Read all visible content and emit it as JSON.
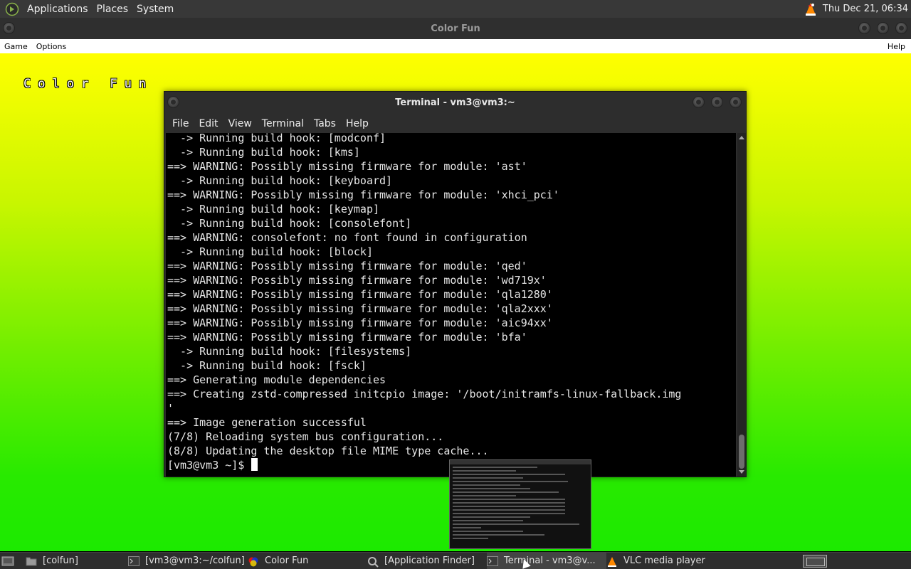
{
  "top_panel": {
    "menus": [
      "Applications",
      "Places",
      "System"
    ],
    "clock": "Thu Dec 21, 06:34"
  },
  "app_window": {
    "title": "Color Fun",
    "menubar": {
      "game": "Game",
      "options": "Options",
      "help": "Help"
    },
    "logo_text": "Color Fun",
    "gradient": [
      "#ffff00",
      "#1cea00"
    ]
  },
  "terminal": {
    "title": "Terminal - vm3@vm3:~",
    "menubar": [
      "File",
      "Edit",
      "View",
      "Terminal",
      "Tabs",
      "Help"
    ],
    "lines": [
      "  -> Running build hook: [modconf]",
      "  -> Running build hook: [kms]",
      "==> WARNING: Possibly missing firmware for module: 'ast'",
      "  -> Running build hook: [keyboard]",
      "==> WARNING: Possibly missing firmware for module: 'xhci_pci'",
      "  -> Running build hook: [keymap]",
      "  -> Running build hook: [consolefont]",
      "==> WARNING: consolefont: no font found in configuration",
      "  -> Running build hook: [block]",
      "==> WARNING: Possibly missing firmware for module: 'qed'",
      "==> WARNING: Possibly missing firmware for module: 'wd719x'",
      "==> WARNING: Possibly missing firmware for module: 'qla1280'",
      "==> WARNING: Possibly missing firmware for module: 'qla2xxx'",
      "==> WARNING: Possibly missing firmware for module: 'aic94xx'",
      "==> WARNING: Possibly missing firmware for module: 'bfa'",
      "  -> Running build hook: [filesystems]",
      "  -> Running build hook: [fsck]",
      "==> Generating module dependencies",
      "==> Creating zstd-compressed initcpio image: '/boot/initramfs-linux-fallback.img",
      "'",
      "==> Image generation successful",
      "(7/8) Reloading system bus configuration...",
      "(8/8) Updating the desktop file MIME type cache..."
    ],
    "prompt": "[vm3@vm3 ~]$"
  },
  "taskbar": {
    "tasks": [
      {
        "label": "[colfun]",
        "icon": "folder-icon"
      },
      {
        "label": "[vm3@vm3:~/colfun]",
        "icon": "terminal-icon"
      },
      {
        "label": "Color Fun",
        "icon": "color-fun-icon"
      },
      {
        "label": "[Application Finder]",
        "icon": "search-icon"
      },
      {
        "label": "Terminal - vm3@v...",
        "icon": "terminal-icon"
      },
      {
        "label": "VLC media player",
        "icon": "vlc-icon"
      }
    ]
  }
}
